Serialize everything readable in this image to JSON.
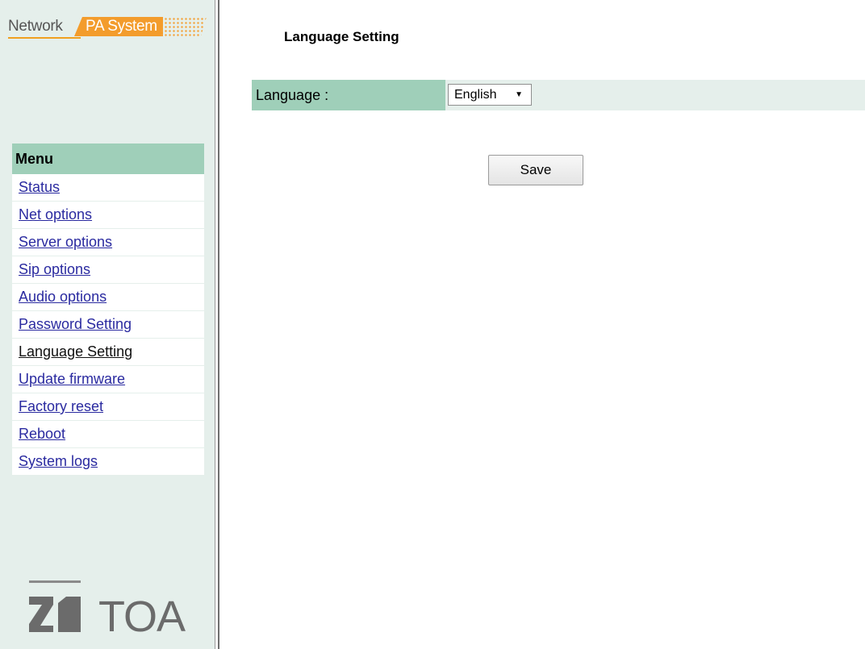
{
  "brand": {
    "network_label": "Network",
    "system_label": "PA System"
  },
  "menu": {
    "header": "Menu",
    "items": [
      {
        "label": "Status",
        "active": false
      },
      {
        "label": "Net options",
        "active": false
      },
      {
        "label": "Server options",
        "active": false
      },
      {
        "label": "Sip options",
        "active": false
      },
      {
        "label": "Audio options",
        "active": false
      },
      {
        "label": "Password Setting",
        "active": false
      },
      {
        "label": "Language Setting",
        "active": true
      },
      {
        "label": "Update firmware",
        "active": false
      },
      {
        "label": "Factory reset",
        "active": false
      },
      {
        "label": "Reboot",
        "active": false
      },
      {
        "label": "System logs",
        "active": false
      }
    ]
  },
  "logo": {
    "text": "TOA"
  },
  "page": {
    "title": "Language Setting",
    "language_label": "Language :",
    "language_value": "English",
    "save_label": "Save"
  },
  "colors": {
    "menu_header_bg": "#9fcfb9",
    "sidebar_bg": "#e5efeb",
    "brand_orange": "#f39c2c",
    "link_color": "#2a2aa0"
  }
}
